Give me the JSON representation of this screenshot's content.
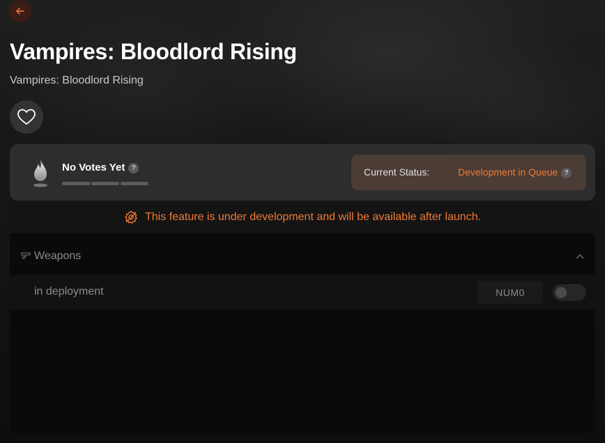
{
  "header": {
    "back_icon": "arrow-left-icon",
    "title": "Vampires: Bloodlord Rising",
    "subtitle": "Vampires: Bloodlord Rising",
    "favorite_icon": "heart-icon"
  },
  "vote": {
    "label": "No Votes Yet",
    "help": "?",
    "bar_count": 3,
    "status_label": "Current Status:",
    "status_value": "Development in Queue",
    "status_help": "?"
  },
  "notice": {
    "text": "This feature is under development and will be available after launch."
  },
  "section": {
    "title": "Weapons",
    "rows": [
      {
        "label": "in deployment",
        "key": "NUM0",
        "enabled": false
      }
    ]
  },
  "colors": {
    "accent": "#f07a35",
    "status_bg": "#4b3c35",
    "card_bg": "#303030"
  }
}
